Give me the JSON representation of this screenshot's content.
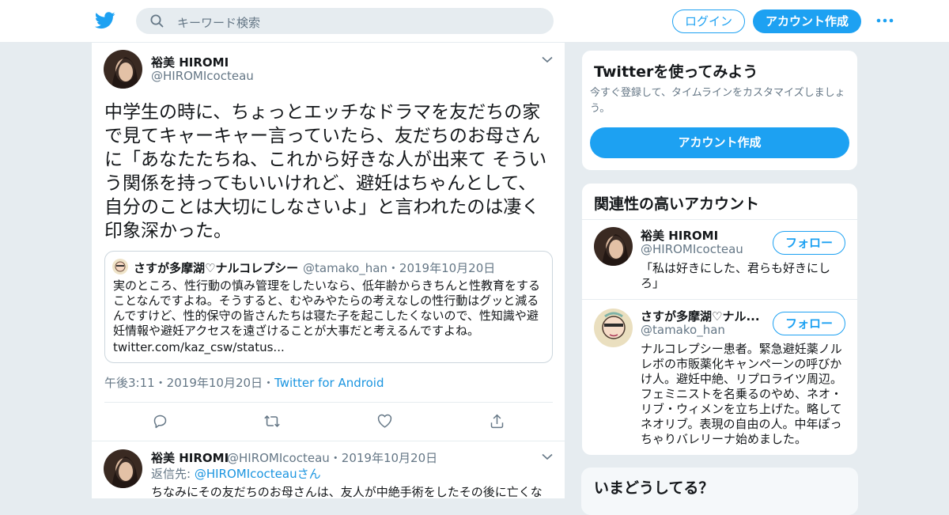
{
  "header": {
    "search_placeholder": "キーワード検索",
    "login_label": "ログイン",
    "signup_label": "アカウント作成",
    "brand_color": "#1da1f2"
  },
  "tweet": {
    "author_name": "裕美 HIROMI",
    "author_handle": "@HIROMIcocteau",
    "text": "中学生の時に、ちょっとエッチなドラマを友だちの家で見てキャーキャー言っていたら、友だちのお母さんに「あなたたちね、これから好きな人が出来て そういう関係を持ってもいいけれど、避妊はちゃんとして、自分のことは大切にしなさいよ」と言われたのは凄く印象深かった。",
    "quote": {
      "name": "さすが多摩湖♡ナルコレプシー",
      "handle_date": "@tamako_han・2019年10月20日",
      "text": "実のところ、性行動の慎み管理をしたいなら、低年齢からきちんと性教育をすることなんですよね。そうすると、むやみやたらの考えなしの性行動はグッと減るんですけど、性的保守の皆さんたちは寝た子を起こしたくないので、性知識や避妊情報や避妊アクセスを遠ざけることが大事だと考えるんですよね。",
      "link": "twitter.com/kaz_csw/status..."
    },
    "timestamp": "午後3:11・2019年10月20日・",
    "source": "Twitter for Android"
  },
  "reply": {
    "author_name": "裕美 HIROMI",
    "handle_date": "@HIROMIcocteau・2019年10月20日",
    "reply_to_prefix": "返信先: ",
    "reply_to_handle": "@HIROMIcocteau",
    "reply_to_suffix": "さん",
    "text": "ちなみにその友だちのお母さんは、友人が中絶手術をしたその後に亡くな"
  },
  "sidebar": {
    "try_card": {
      "title": "Twitterを使ってみよう",
      "subtitle": "今すぐ登録して、タイムラインをカスタマイズしましょう。",
      "button": "アカウント作成"
    },
    "related": {
      "title": "関連性の高いアカウント",
      "accounts": [
        {
          "name": "裕美 HIROMI",
          "handle": "@HIROMIcocteau",
          "bio": "「私は好きにした、君らも好きにしろ」",
          "follow": "フォロー"
        },
        {
          "name": "さすが多摩湖♡ナル...",
          "handle": "@tamako_han",
          "bio": "ナルコレプシー患者。緊急避妊薬ノルレボの市販薬化キャンペーンの呼びかけ人。避妊中絶、リプロライツ周辺。フェミニストを名乗るのやめ、ネオ・リブ・ウィメンを立ち上げた。略してネオリブ。表現の自由の人。中年ぽっちゃりバレリーナ始めました。",
          "follow": "フォロー"
        }
      ]
    },
    "trends_title": "いまどうしてる？"
  }
}
